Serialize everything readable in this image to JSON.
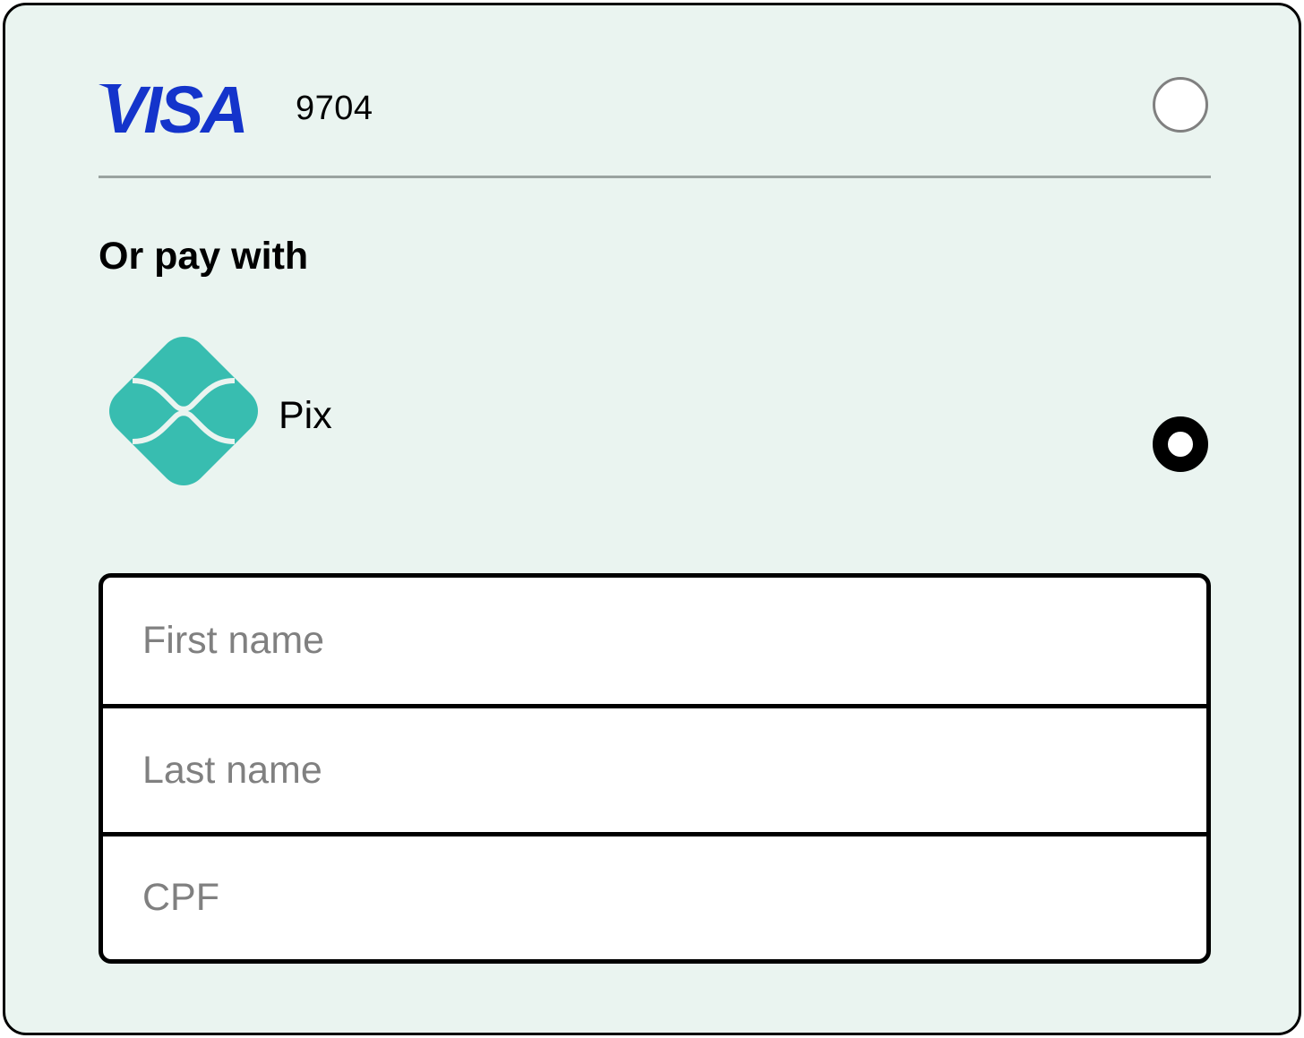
{
  "saved_card": {
    "brand": "VISA",
    "last4": "9704",
    "selected": false
  },
  "alternative": {
    "heading": "Or pay with",
    "method_name": "Pix",
    "selected": true
  },
  "form": {
    "first_name_placeholder": "First name",
    "first_name_value": "",
    "last_name_placeholder": "Last name",
    "last_name_value": "",
    "cpf_placeholder": "CPF",
    "cpf_value": ""
  },
  "icons": {
    "card_brand": "visa-logo",
    "pix": "pix-logo",
    "radio_unselected": "radio-empty",
    "radio_selected": "radio-filled"
  },
  "colors": {
    "card_background": "#eaf4f0",
    "visa_blue": "#1434cb",
    "pix_teal": "#38bdb0",
    "placeholder_gray": "#808080",
    "divider_gray": "#9aa3a0"
  }
}
